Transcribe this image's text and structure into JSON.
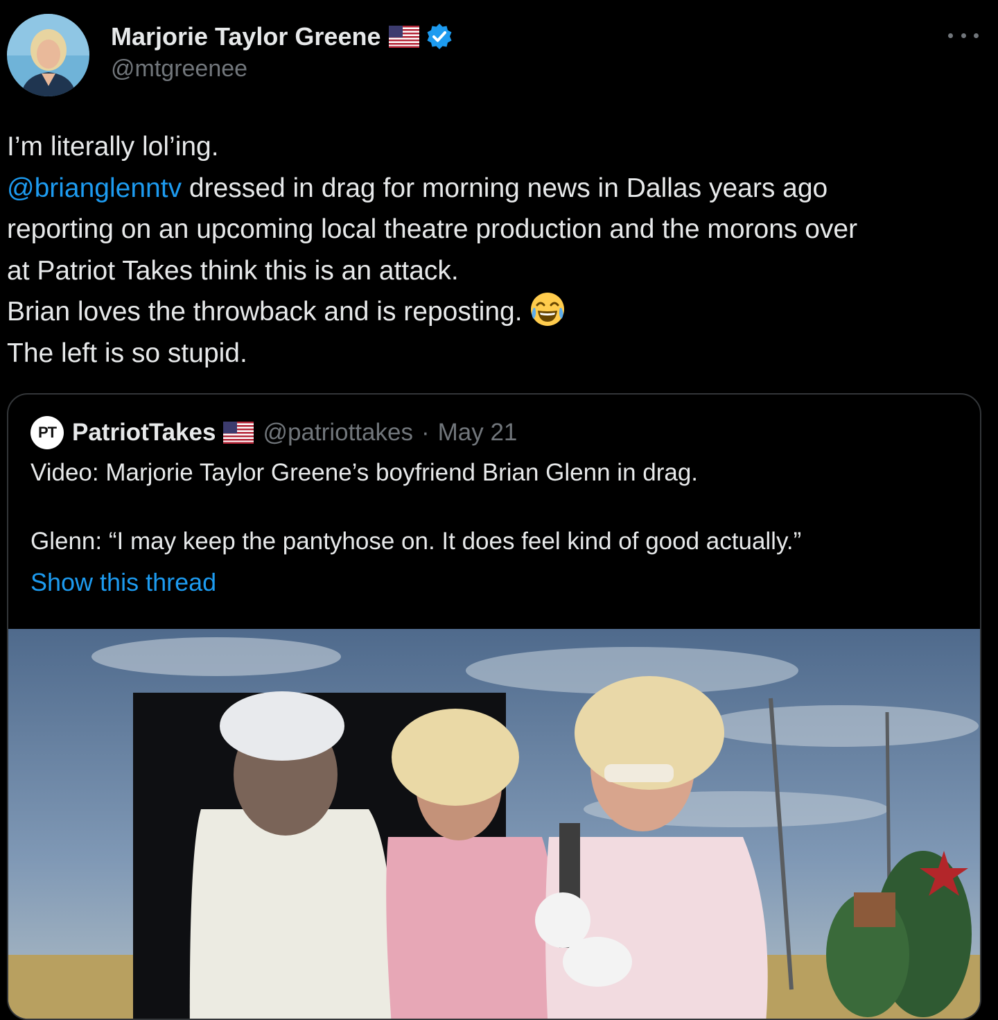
{
  "tweet": {
    "author": {
      "display_name": "Marjorie Taylor Greene",
      "handle": "@mtgreenee",
      "flag_icon": "us-flag-icon",
      "verified_icon": "verified-badge-icon"
    },
    "text_lines": [
      "I’m literally lol’ing.",
      "dressed in drag for morning news in Dallas years ago",
      "reporting on an upcoming local theatre production and the morons over",
      "at Patriot Takes think this is an attack.",
      "Brian loves the throwback and is reposting.",
      "The left is so stupid."
    ],
    "mention": "@brianglenntv",
    "emoji": "😂",
    "more_icon": "more-options-icon"
  },
  "quote": {
    "avatar_text": "PT",
    "display_name": "PatriotTakes",
    "handle": "@patriottakes",
    "separator": "·",
    "date": "May 21",
    "text_line1": "Video: Marjorie Taylor Greene’s boyfriend Brian Glenn in drag.",
    "text_line2": "Glenn: “I may keep the pantyhose on. It does feel kind of good actually.”",
    "show_thread": "Show this thread"
  },
  "colors": {
    "background": "#000000",
    "text": "#e7e9ea",
    "secondary": "#71767b",
    "link": "#1d9bf0",
    "border": "#333639"
  }
}
